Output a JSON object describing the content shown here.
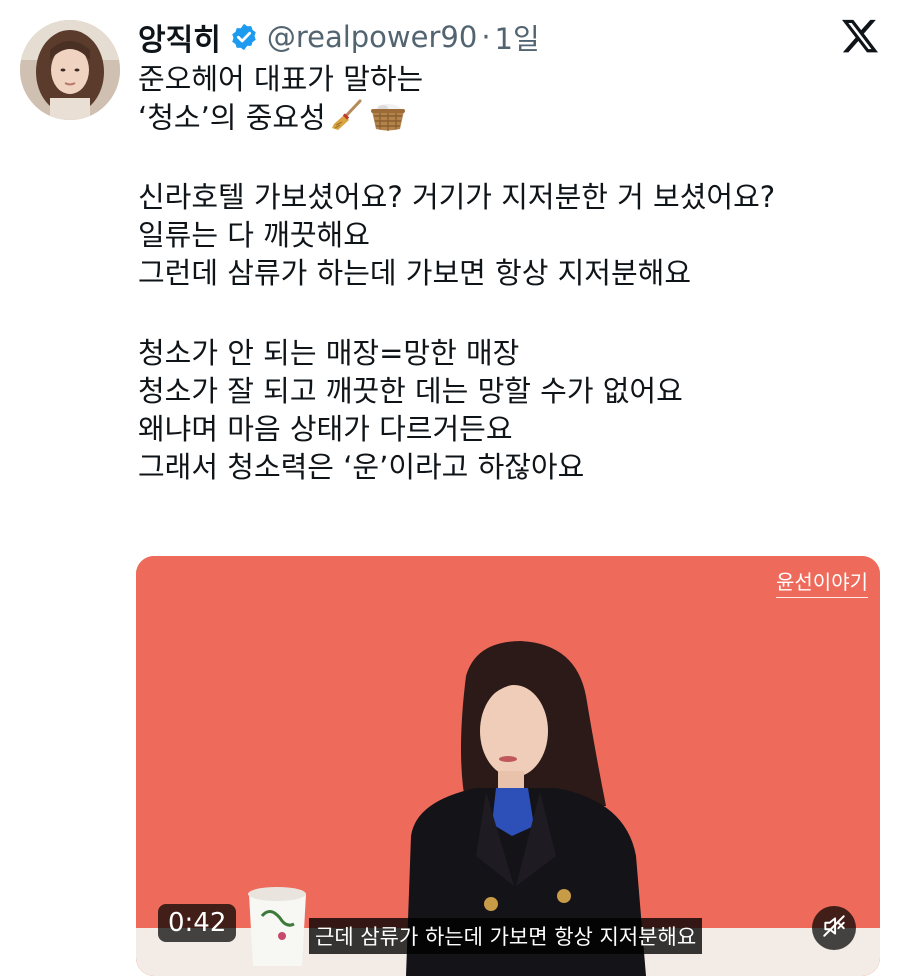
{
  "author": {
    "display_name": "앙직히",
    "handle": "@realpower90",
    "separator": "·",
    "time": "1일",
    "verified_color": "#1d9bf0"
  },
  "header": {
    "platform_icon": "x-logo-icon"
  },
  "tweet": {
    "lines": [
      "준오헤어 대표가 말하는",
      "‘청소’의 중요성",
      "",
      "신라호텔 가보셨어요? 거기가 지저분한 거 보셨어요?",
      "일류는 다 깨끗해요",
      "그런데 삼류가 하는데 가보면 항상 지저분해요",
      "",
      "청소가 안 되는 매장=망한 매장",
      "청소가 잘 되고 깨끗한 데는 망할 수가 없어요",
      "왜냐며 마음 상태가 다르거든요",
      "그래서 청소력은 ‘운’이라고 하잖아요"
    ],
    "emojis": [
      "broom-icon",
      "basket-icon"
    ]
  },
  "media": {
    "channel_watermark": "윤선이야기",
    "duration": "0:42",
    "subtitle": "근데 삼류가 하는데 가보면 항상 지저분해요",
    "mute_icon": "muted-speaker-icon",
    "background_color": "#ee6b5b"
  }
}
